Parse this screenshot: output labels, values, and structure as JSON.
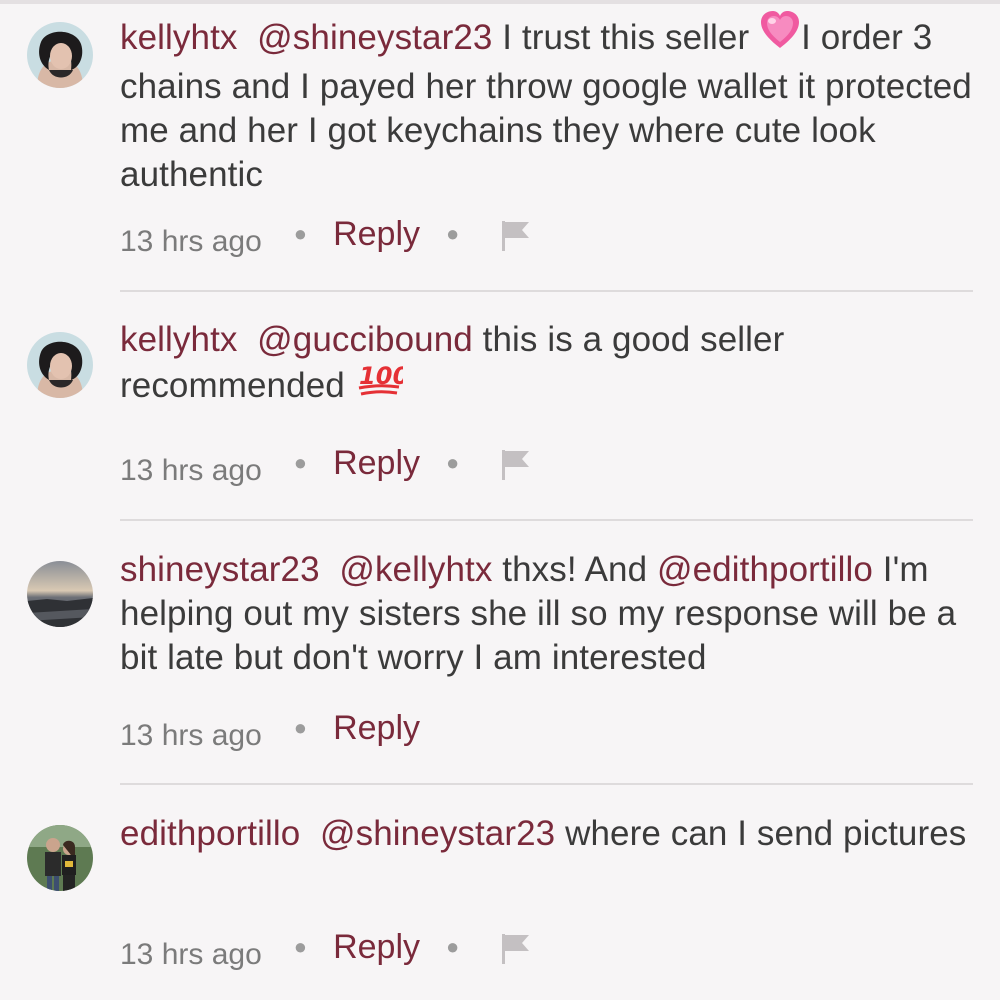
{
  "comments": [
    {
      "username": "kellyhtx",
      "mention": "@shineystar23",
      "text_before": " I trust this seller ",
      "emoji": "sparkling-heart",
      "text_after": "I order 3 chains and I payed her throw google wallet it protected me and her I got keychains they where cute look authentic",
      "time": "13 hrs ago",
      "reply_label": "Reply",
      "has_flag": true
    },
    {
      "username": "kellyhtx",
      "mention": "@guccibound",
      "text_before": " this is a good seller recommended ",
      "emoji": "hundred-points",
      "text_after": "",
      "time": "13 hrs ago",
      "reply_label": "Reply",
      "has_flag": true
    },
    {
      "username": "shineystar23",
      "mention": "@kellyhtx",
      "text_before": " thxs! And ",
      "mention2": "@edithportillo",
      "text_after": " I'm helping out my sisters she ill so my response will be a bit late but don't worry I am interested",
      "time": "13 hrs ago",
      "reply_label": "Reply",
      "has_flag": false
    },
    {
      "username": "edithportillo",
      "mention": "@shineystar23",
      "text_before": " where can I send pictures",
      "time": "13 hrs ago",
      "reply_label": "Reply",
      "has_flag": true
    }
  ],
  "colors": {
    "accent": "#7a2a3b",
    "text": "#3b3b3b",
    "meta": "#7b7b7b",
    "background": "#f7f5f6"
  },
  "icons": [
    "avatar",
    "sparkling-heart-emoji",
    "hundred-points-emoji",
    "flag-icon"
  ]
}
